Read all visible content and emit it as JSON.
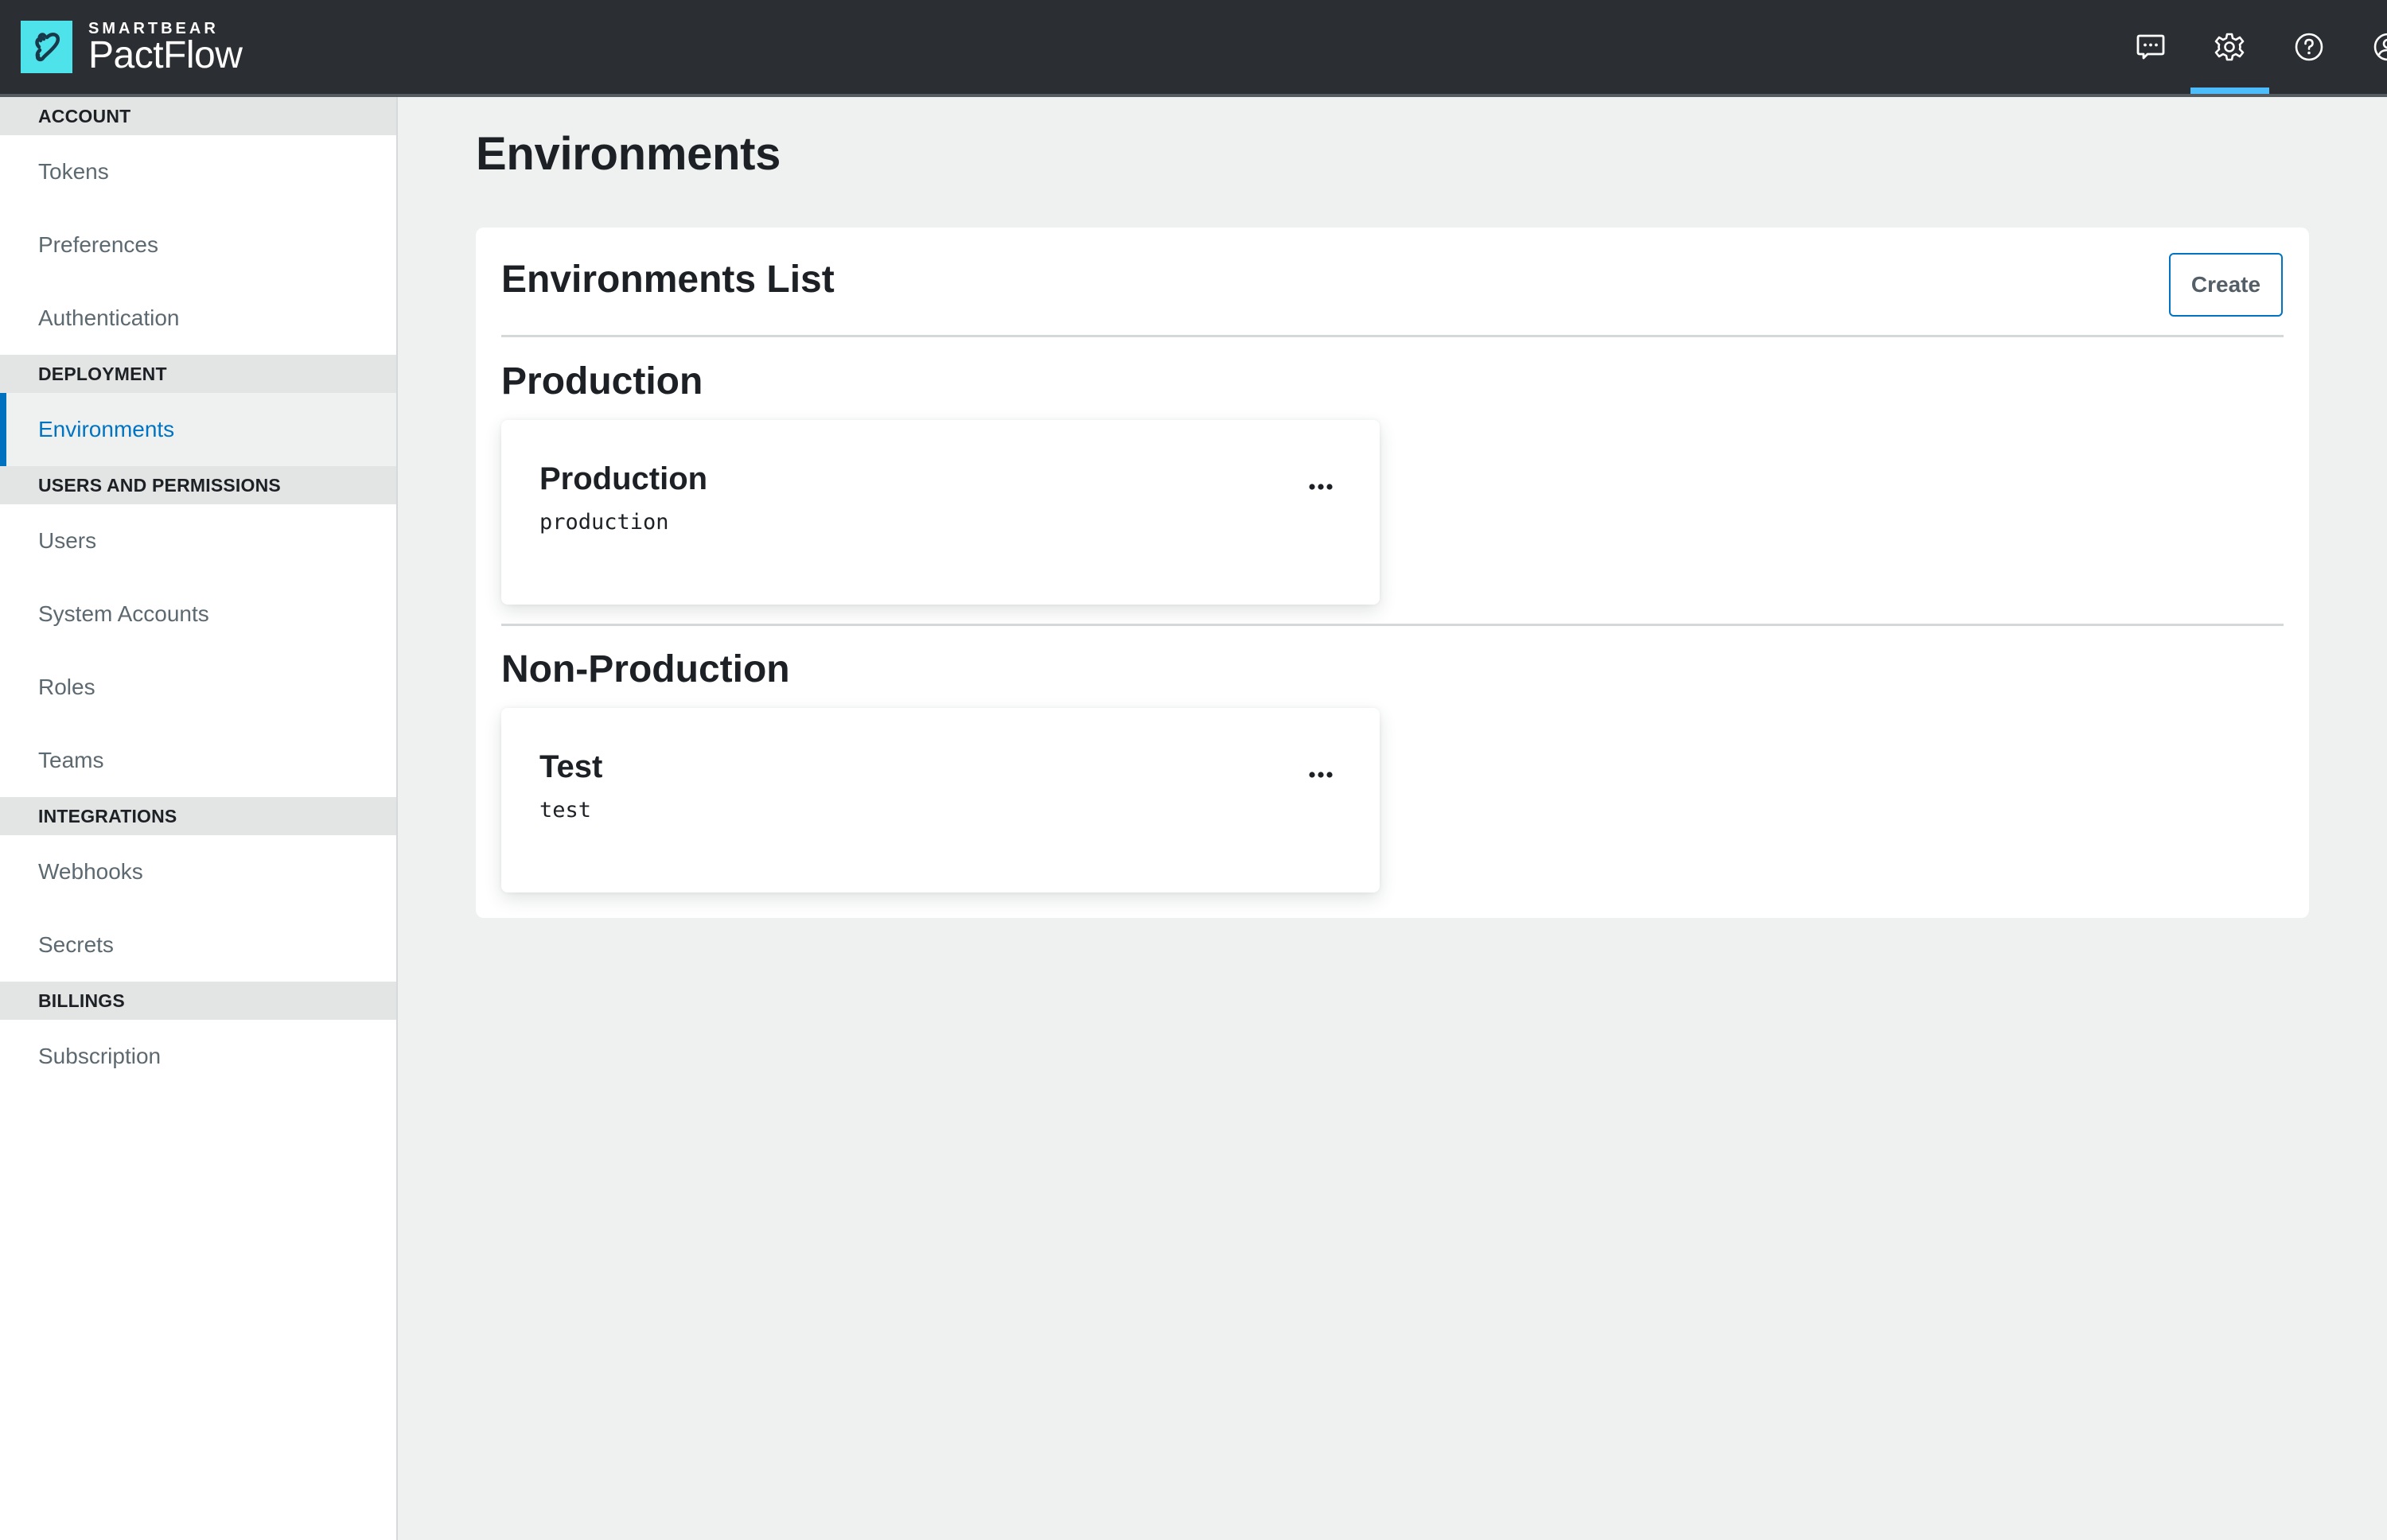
{
  "header": {
    "brand_company": "SMARTBEAR",
    "brand_product": "PactFlow",
    "logo_icon": "pactflow-logo-icon",
    "icons": [
      {
        "name": "feedback-icon",
        "label": "Feedback"
      },
      {
        "name": "settings-gear-icon",
        "label": "Settings",
        "active": true
      },
      {
        "name": "help-icon",
        "label": "Help"
      },
      {
        "name": "user-account-icon",
        "label": "Account"
      }
    ],
    "colors": {
      "background": "#2b2f33",
      "active_indicator": "#4cbdfa",
      "logo_bg": "#4ee3ea"
    }
  },
  "sidebar": {
    "sections": [
      {
        "title": "ACCOUNT",
        "items": [
          {
            "label": "Tokens"
          },
          {
            "label": "Preferences"
          },
          {
            "label": "Authentication"
          }
        ]
      },
      {
        "title": "DEPLOYMENT",
        "items": [
          {
            "label": "Environments",
            "active": true
          }
        ]
      },
      {
        "title": "USERS AND PERMISSIONS",
        "items": [
          {
            "label": "Users"
          },
          {
            "label": "System Accounts"
          },
          {
            "label": "Roles"
          },
          {
            "label": "Teams"
          }
        ]
      },
      {
        "title": "INTEGRATIONS",
        "items": [
          {
            "label": "Webhooks"
          },
          {
            "label": "Secrets"
          }
        ]
      },
      {
        "title": "BILLINGS",
        "items": [
          {
            "label": "Subscription"
          }
        ]
      }
    ],
    "active_color": "#0074c2"
  },
  "main": {
    "page_title": "Environments",
    "panel": {
      "title": "Environments List",
      "create_label": "Create",
      "groups": [
        {
          "heading": "Production",
          "environments": [
            {
              "name": "Production",
              "slug": "production",
              "menu_icon": "more-horizontal-icon"
            }
          ]
        },
        {
          "heading": "Non-Production",
          "environments": [
            {
              "name": "Test",
              "slug": "test",
              "menu_icon": "more-horizontal-icon"
            }
          ]
        }
      ]
    }
  }
}
